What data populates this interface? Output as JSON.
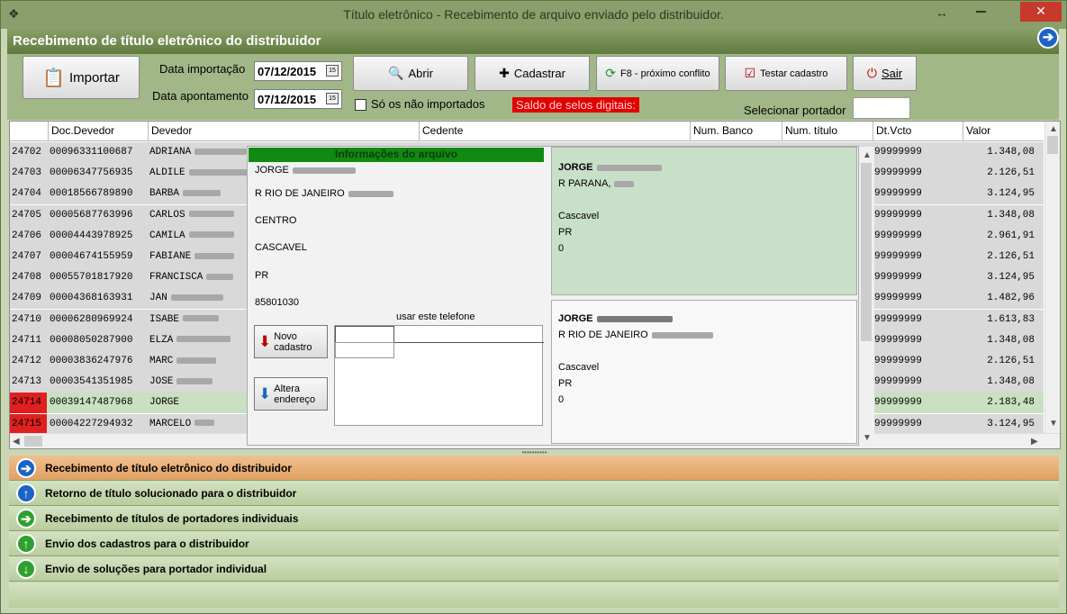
{
  "window": {
    "title": "Título eletrônico - Recebimento de arquivo enviado pelo distribuidor.",
    "resize_glyph": "↔",
    "close_glyph": "✕"
  },
  "header": {
    "title": "Recebimento de título eletrônico do distribuidor"
  },
  "toolbar": {
    "importar": "Importar",
    "data_importacao_label": "Data importação",
    "data_importacao_value": "07/12/2015",
    "data_apontamento_label": "Data apontamento",
    "data_apontamento_value": "07/12/2015",
    "abrir": "Abrir",
    "cadastrar": "Cadastrar",
    "proximo_conflito": "F8 - próximo conflito",
    "testar_cadastro": "Testar cadastro",
    "sair": "Sair",
    "so_nao_importados": "Só os não importados",
    "saldo": "Saldo de selos digitais:",
    "selecionar_portador": "Selecionar portador",
    "cal_glyph": "15"
  },
  "grid": {
    "columns": [
      "Doc.Devedor",
      "Devedor",
      "Cedente",
      "Num. Banco",
      "Num. título",
      "Dt.Vcto",
      "Valor"
    ],
    "rows": [
      {
        "id": "24702",
        "doc": "00096331100687",
        "devedor": "ADRIANA",
        "venc": "99999999",
        "valor": "1.348,08"
      },
      {
        "id": "24703",
        "doc": "00006347756935",
        "devedor": "ALDILE",
        "venc": "99999999",
        "valor": "2.126,51"
      },
      {
        "id": "24704",
        "doc": "00018566789890",
        "devedor": "BARBA",
        "venc": "99999999",
        "valor": "3.124,95"
      },
      {
        "id": "24705",
        "doc": "00005687763996",
        "devedor": "CARLOS",
        "venc": "99999999",
        "valor": "1.348,08"
      },
      {
        "id": "24706",
        "doc": "00004443978925",
        "devedor": "CAMILA",
        "venc": "99999999",
        "valor": "2.961,91"
      },
      {
        "id": "24707",
        "doc": "00004674155959",
        "devedor": "FABIANE",
        "venc": "99999999",
        "valor": "2.126,51"
      },
      {
        "id": "24708",
        "doc": "00055701817920",
        "devedor": "FRANCISCA",
        "venc": "99999999",
        "valor": "3.124,95"
      },
      {
        "id": "24709",
        "doc": "00004368163931",
        "devedor": "JAN",
        "venc": "99999999",
        "valor": "1.482,96"
      },
      {
        "id": "24710",
        "doc": "00006280969924",
        "devedor": "ISABE",
        "venc": "99999999",
        "valor": "1.613,83"
      },
      {
        "id": "24711",
        "doc": "00008050287900",
        "devedor": "ELZA",
        "venc": "99999999",
        "valor": "1.348,08"
      },
      {
        "id": "24712",
        "doc": "00003836247976",
        "devedor": "MARC",
        "venc": "99999999",
        "valor": "2.126,51"
      },
      {
        "id": "24713",
        "doc": "00003541351985",
        "devedor": "JOSE",
        "venc": "99999999",
        "valor": "1.348,08"
      },
      {
        "id": "24714",
        "doc": "00039147487968",
        "devedor": "JORGE",
        "venc": "99999999",
        "valor": "2.183,48"
      },
      {
        "id": "24715",
        "doc": "00004227294932",
        "devedor": "MARCELO",
        "venc": "99999999",
        "valor": "3.124,95"
      }
    ]
  },
  "popup": {
    "info_title": "Informações do arquivo",
    "nome": "JORGE",
    "endereco": "R RIO DE JANEIRO",
    "bairro": "CENTRO",
    "cidade": "CASCAVEL",
    "uf": "PR",
    "cep": "85801030",
    "telefone_label": "usar este telefone",
    "novo_cadastro": "Novo cadastro",
    "altera_endereco": "Altera endereço",
    "addr1": {
      "nome": "JORGE",
      "endereco": "R PARANA,",
      "cidade": "Cascavel",
      "uf": "PR",
      "num": "0"
    },
    "addr2": {
      "nome": "JORGE",
      "endereco": "R RIO DE JANEIRO",
      "cidade": "Cascavel",
      "uf": "PR",
      "num": "0"
    }
  },
  "nav": [
    {
      "label": "Recebimento de título eletrônico do distribuidor",
      "icon": "arrow-right-icon",
      "glyph": "➔",
      "color": "blue",
      "active": true
    },
    {
      "label": "Retorno de título solucionado para o distribuidor",
      "icon": "arrow-up-icon",
      "glyph": "↑",
      "color": "blue",
      "active": false
    },
    {
      "label": "Recebimento de títulos de portadores individuais",
      "icon": "arrow-right-icon",
      "glyph": "➔",
      "color": "green",
      "active": false
    },
    {
      "label": "Envio dos cadastros para o distribuidor",
      "icon": "arrow-up-icon",
      "glyph": "↑",
      "color": "green",
      "active": false
    },
    {
      "label": "Envio de soluções para portador individual",
      "icon": "arrow-down-icon",
      "glyph": "↓",
      "color": "green",
      "active": false
    }
  ]
}
